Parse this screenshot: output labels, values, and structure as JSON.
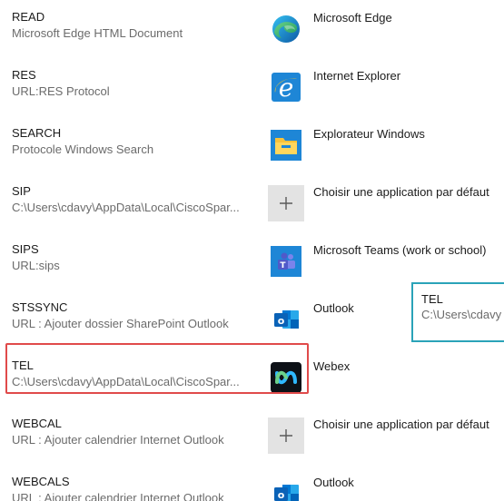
{
  "rows": [
    {
      "protocol": "READ",
      "description": "Microsoft Edge HTML Document",
      "app": "Microsoft Edge",
      "icon": "microsoft-edge-icon"
    },
    {
      "protocol": "RES",
      "description": "URL:RES Protocol",
      "app": "Internet Explorer",
      "icon": "internet-explorer-icon"
    },
    {
      "protocol": "SEARCH",
      "description": "Protocole Windows Search",
      "app": "Explorateur Windows",
      "icon": "file-explorer-icon"
    },
    {
      "protocol": "SIP",
      "description": "C:\\Users\\cdavy\\AppData\\Local\\CiscoSpar...",
      "app": "Choisir une application par défaut",
      "icon": "plus-icon"
    },
    {
      "protocol": "SIPS",
      "description": "URL:sips",
      "app": "Microsoft Teams (work or school)",
      "icon": "microsoft-teams-icon"
    },
    {
      "protocol": "STSSYNC",
      "description": "URL : Ajouter dossier SharePoint Outlook",
      "app": "Outlook",
      "icon": "outlook-icon"
    },
    {
      "protocol": "TEL",
      "description": "C:\\Users\\cdavy\\AppData\\Local\\CiscoSpar...",
      "app": "Webex",
      "icon": "webex-icon"
    },
    {
      "protocol": "WEBCAL",
      "description": "URL : Ajouter calendrier Internet Outlook",
      "app": "Choisir une application par défaut",
      "icon": "plus-icon"
    },
    {
      "protocol": "WEBCALS",
      "description": "URL : Ajouter calendrier Internet Outlook",
      "app": "Outlook",
      "icon": "outlook-icon"
    }
  ],
  "tooltip": {
    "name": "TEL",
    "description": "C:\\Users\\cdavy"
  },
  "colors": {
    "selection_border": "#e04a4a",
    "tooltip_border": "#2aa3b8"
  }
}
